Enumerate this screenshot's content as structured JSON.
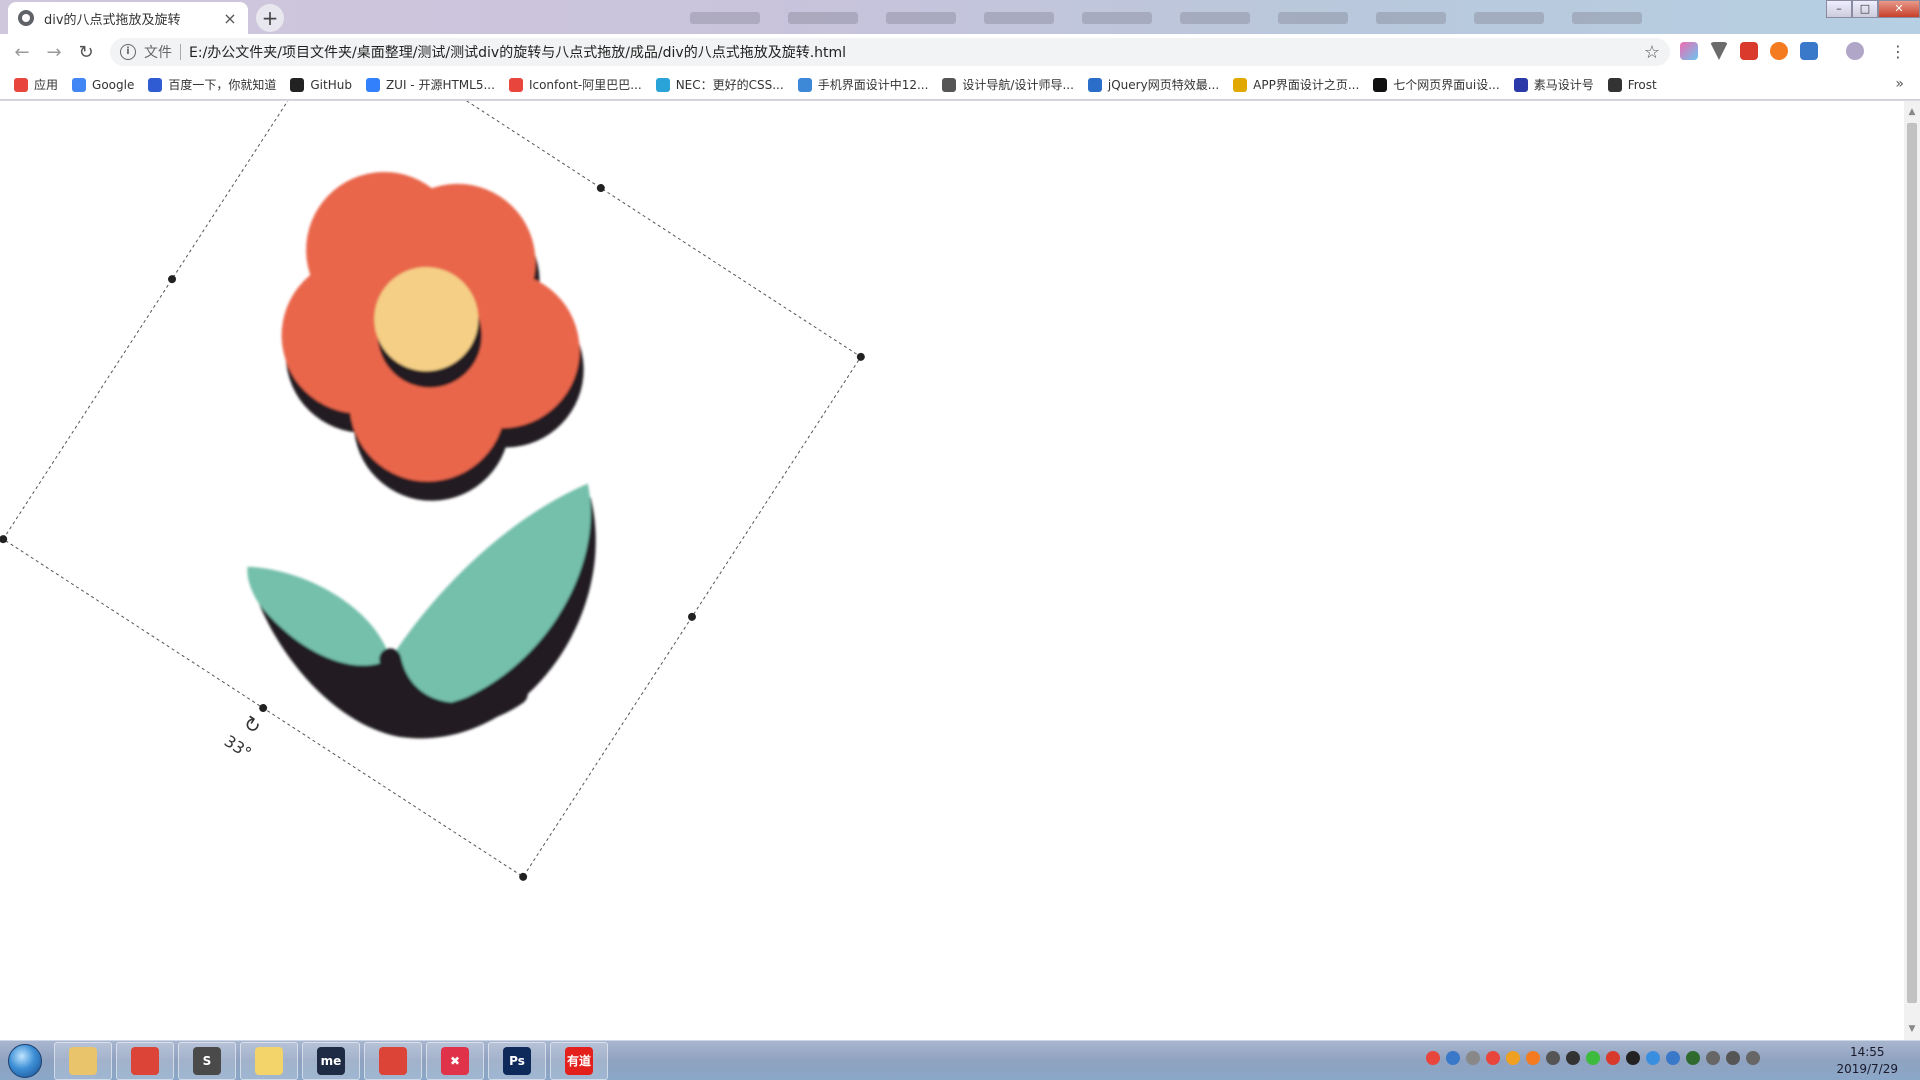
{
  "tab": {
    "title": "div的八点式拖放及旋转",
    "close": "×"
  },
  "newtab": "+",
  "window_controls": {
    "minimize": "–",
    "maximize": "□",
    "close": "✕"
  },
  "toolbar": {
    "back": "←",
    "forward": "→",
    "reload": "↻",
    "scheme_label": "文件",
    "url": "E:/办公文件夹/项目文件夹/桌面整理/测试/测试div的旋转与八点式拖放/成品/div的八点式拖放及旋转.html",
    "bookmark_star": "☆",
    "menu": "⋮"
  },
  "bookmarks": [
    {
      "label": "应用",
      "icon": "apps-grid-icon",
      "color": "#e8453c"
    },
    {
      "label": "Google",
      "icon": "google-icon",
      "color": "#4285f4"
    },
    {
      "label": "百度一下，你就知道",
      "icon": "baidu-paw-icon",
      "color": "#2f5bd3"
    },
    {
      "label": "GitHub",
      "icon": "github-icon",
      "color": "#222222"
    },
    {
      "label": "ZUI - 开源HTML5...",
      "icon": "zui-icon",
      "color": "#3280fc"
    },
    {
      "label": "Iconfont-阿里巴巴...",
      "icon": "iconfont-icon",
      "color": "#e8453c"
    },
    {
      "label": "NEC：更好的CSS...",
      "icon": "nec-icon",
      "color": "#2aa3d9"
    },
    {
      "label": "手机界面设计中12...",
      "icon": "paper-plane-icon",
      "color": "#3e88d8"
    },
    {
      "label": "设计导航/设计师导...",
      "icon": "nav-icon",
      "color": "#555555"
    },
    {
      "label": "jQuery网页特效最...",
      "icon": "jquery-icon",
      "color": "#2a6ec9"
    },
    {
      "label": "APP界面设计之页...",
      "icon": "app-icon",
      "color": "#e0a800"
    },
    {
      "label": "七个网页界面ui设...",
      "icon": "s-icon",
      "color": "#111111"
    },
    {
      "label": "素马设计号",
      "icon": "suma-icon",
      "color": "#2b3aa8"
    },
    {
      "label": "Frost",
      "icon": "snowflake-icon",
      "color": "#333333"
    }
  ],
  "bookmarks_more": "»",
  "rotation": {
    "angle_deg": 33,
    "label": "33°",
    "handle_glyph": "↻"
  },
  "colors": {
    "petal": "#e9664b",
    "center": "#f5cf86",
    "leaf": "#74c0ab",
    "outline": "#231f20",
    "handle": "#222222"
  },
  "taskbar": {
    "apps": [
      {
        "name": "explorer",
        "label": "",
        "color": "#e9c46a"
      },
      {
        "name": "chrome",
        "label": "",
        "color": "#db4437"
      },
      {
        "name": "sublime",
        "label": "S",
        "color": "#4a4a4a"
      },
      {
        "name": "folder",
        "label": "",
        "color": "#f2d46b"
      },
      {
        "name": "me",
        "label": "me",
        "color": "#1f2a44"
      },
      {
        "name": "chrome-2",
        "label": "",
        "color": "#db4437"
      },
      {
        "name": "xmind",
        "label": "✖",
        "color": "#e0334a"
      },
      {
        "name": "photoshop",
        "label": "Ps",
        "color": "#0d2a5b"
      },
      {
        "name": "youdao",
        "label": "有道",
        "color": "#e3201b"
      }
    ],
    "time": "14:55",
    "date": "2019/7/29"
  }
}
